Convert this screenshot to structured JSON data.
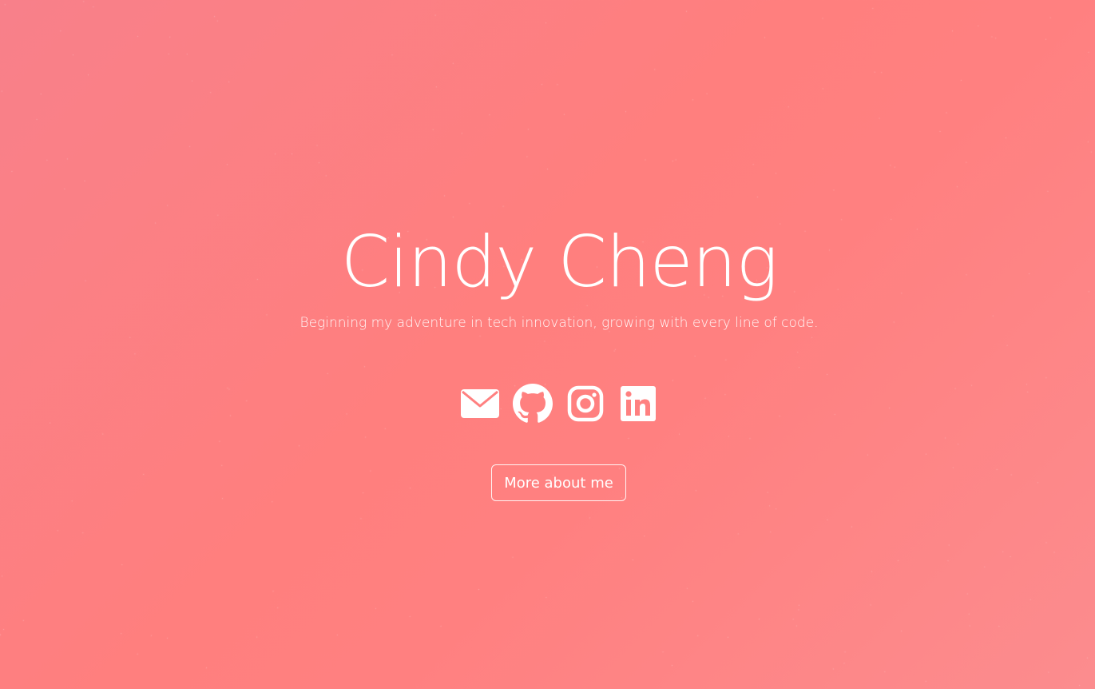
{
  "hero": {
    "name": "Cindy Cheng",
    "tagline": "Beginning my adventure in tech innovation, growing with every line of code.",
    "more_button_label": "More about me"
  },
  "social_links": [
    {
      "icon": "envelope-icon",
      "label": "Email"
    },
    {
      "icon": "github-icon",
      "label": "GitHub"
    },
    {
      "icon": "instagram-icon",
      "label": "Instagram"
    },
    {
      "icon": "linkedin-icon",
      "label": "LinkedIn"
    }
  ],
  "colors": {
    "background_start": "#f8808a",
    "background_mid": "#ff7f7e",
    "background_end": "#fc8c8e",
    "foreground": "#ffffff"
  }
}
